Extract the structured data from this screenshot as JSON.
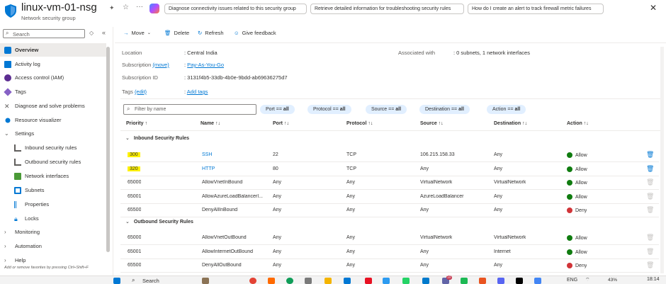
{
  "header": {
    "title": "linux-vm-01-nsg",
    "subtitle": "Network security group",
    "chips": [
      "Diagnose connectivity issues related to this security group",
      "Retrieve detailed information for troubleshooting security rules",
      "How do I create an alert to track firewall metric failures"
    ],
    "close_label": "✕"
  },
  "sidebar": {
    "search_placeholder": "Search",
    "items": [
      {
        "label": "Overview"
      },
      {
        "label": "Activity log"
      },
      {
        "label": "Access control (IAM)"
      },
      {
        "label": "Tags"
      },
      {
        "label": "Diagnose and solve problems"
      },
      {
        "label": "Resource visualizer"
      },
      {
        "label": "Settings"
      },
      {
        "label": "Inbound security rules"
      },
      {
        "label": "Outbound security rules"
      },
      {
        "label": "Network interfaces"
      },
      {
        "label": "Subnets"
      },
      {
        "label": "Properties"
      },
      {
        "label": "Locks"
      },
      {
        "label": "Monitoring"
      },
      {
        "label": "Automation"
      },
      {
        "label": "Help"
      }
    ],
    "footer": "Add or remove favorites by pressing Ctrl+Shift+F"
  },
  "toolbar": {
    "move": "Move",
    "delete": "Delete",
    "refresh": "Refresh",
    "feedback": "Give feedback"
  },
  "essentials": {
    "location_label": "Location",
    "location_value": "Central India",
    "subscription_label": "Subscription",
    "subscription_move": "(move)",
    "subscription_value": "Pay-As-You-Go",
    "subscription_id_label": "Subscription ID",
    "subscription_id_value": "3131f4b5-33db-4b0e-9bdd-ab69636275d7",
    "associated_label": "Associated with",
    "associated_value": "0 subnets, 1 network interfaces",
    "tags_label": "Tags",
    "tags_edit": "(edit)",
    "tags_add": "Add tags"
  },
  "filters": {
    "placeholder": "Filter by name",
    "pills": [
      {
        "key": "Port ==",
        "value": "all"
      },
      {
        "key": "Protocol ==",
        "value": "all"
      },
      {
        "key": "Source ==",
        "value": "all"
      },
      {
        "key": "Destination ==",
        "value": "all"
      },
      {
        "key": "Action ==",
        "value": "all"
      }
    ]
  },
  "table": {
    "headers": [
      "Priority",
      "Name",
      "Port",
      "Protocol",
      "Source",
      "Destination",
      "Action"
    ],
    "inbound_title": "Inbound Security Rules",
    "outbound_title": "Outbound Security Rules",
    "inbound": [
      {
        "priority": "300",
        "name": "SSH",
        "port": "22",
        "protocol": "TCP",
        "source": "106.215.158.33",
        "destination": "Any",
        "action": "Allow"
      },
      {
        "priority": "320",
        "name": "HTTP",
        "port": "80",
        "protocol": "TCP",
        "source": "Any",
        "destination": "Any",
        "action": "Allow"
      },
      {
        "priority": "65000",
        "name": "AllowVnetInBound",
        "port": "Any",
        "protocol": "Any",
        "source": "VirtualNetwork",
        "destination": "VirtualNetwork",
        "action": "Allow"
      },
      {
        "priority": "65001",
        "name": "AllowAzureLoadBalancerI...",
        "port": "Any",
        "protocol": "Any",
        "source": "AzureLoadBalancer",
        "destination": "Any",
        "action": "Allow"
      },
      {
        "priority": "65500",
        "name": "DenyAllInBound",
        "port": "Any",
        "protocol": "Any",
        "source": "Any",
        "destination": "Any",
        "action": "Deny"
      }
    ],
    "outbound": [
      {
        "priority": "65000",
        "name": "AllowVnetOutBound",
        "port": "Any",
        "protocol": "Any",
        "source": "VirtualNetwork",
        "destination": "VirtualNetwork",
        "action": "Allow"
      },
      {
        "priority": "65001",
        "name": "AllowInternetOutBound",
        "port": "Any",
        "protocol": "Any",
        "source": "Any",
        "destination": "Internet",
        "action": "Allow"
      },
      {
        "priority": "65500",
        "name": "DenyAllOutBound",
        "port": "Any",
        "protocol": "Any",
        "source": "Any",
        "destination": "Any",
        "action": "Deny"
      }
    ]
  },
  "taskbar": {
    "search": "Search",
    "lang": "ENG",
    "battery": "43%",
    "time": "18:14",
    "badge": "10"
  },
  "colors": {
    "accent": "#0078d4",
    "allow": "#107c10",
    "deny": "#d13438",
    "highlight": "#fff200"
  }
}
